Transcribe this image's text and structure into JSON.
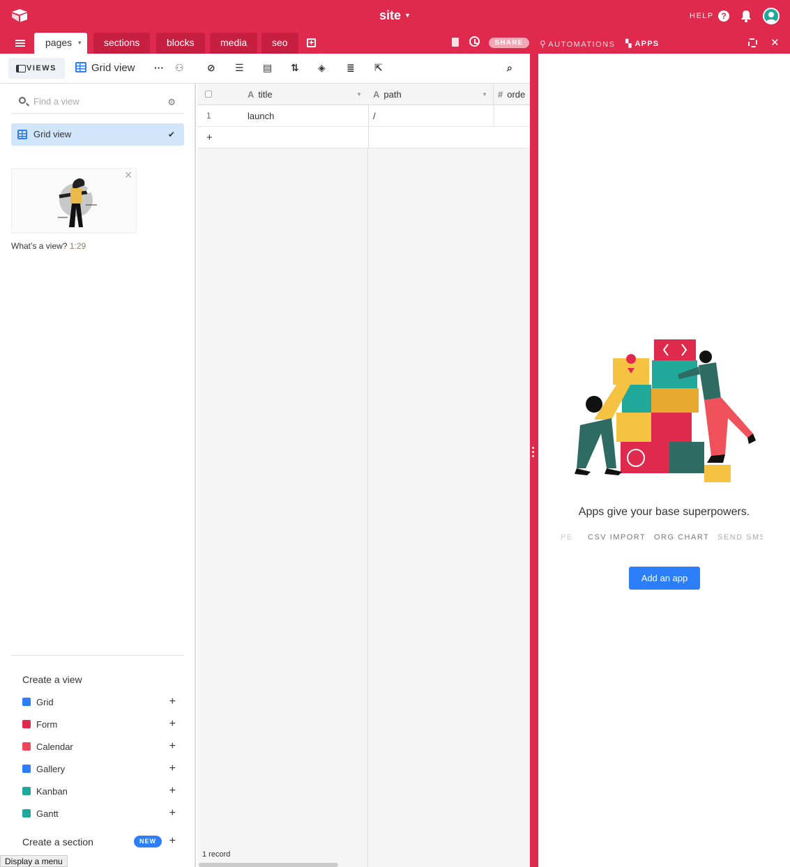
{
  "header": {
    "base_title": "site",
    "help_label": "HELP"
  },
  "tabs": [
    {
      "label": "pages",
      "active": true
    },
    {
      "label": "sections"
    },
    {
      "label": "blocks"
    },
    {
      "label": "media"
    },
    {
      "label": "seo"
    }
  ],
  "tab_actions": {
    "share_label": "SHARE",
    "automations_label": "AUTOMATIONS",
    "apps_label": "APPS"
  },
  "toolbar": {
    "views_label": "VIEWS",
    "current_view": "Grid view"
  },
  "sidebar": {
    "find_placeholder": "Find a view",
    "active_view": "Grid view",
    "video_caption": "What’s a view?",
    "video_duration": "1:29",
    "create_view_heading": "Create a view",
    "view_types": [
      {
        "label": "Grid",
        "color": "#2d7ff9"
      },
      {
        "label": "Form",
        "color": "#e02a4d"
      },
      {
        "label": "Calendar",
        "color": "#f0455c"
      },
      {
        "label": "Gallery",
        "color": "#2d7ff9"
      },
      {
        "label": "Kanban",
        "color": "#20a99a"
      },
      {
        "label": "Gantt",
        "color": "#20a99a"
      }
    ],
    "create_section_label": "Create a section",
    "new_badge": "NEW"
  },
  "grid": {
    "columns": [
      {
        "label": "title",
        "type_icon": "A"
      },
      {
        "label": "path",
        "type_icon": "A"
      },
      {
        "label": "orde",
        "type_icon": "#"
      }
    ],
    "rows": [
      {
        "num": "1",
        "title": "launch",
        "path": "/"
      }
    ],
    "add_row": "+",
    "record_count": "1 record"
  },
  "apps_panel": {
    "tagline": "Apps give your base superpowers.",
    "marquee": [
      "PE",
      "CSV IMPORT",
      "ORG CHART",
      "SEND SMS"
    ],
    "add_button": "Add an app"
  },
  "tooltip": {
    "display_menu": "Display a menu"
  }
}
